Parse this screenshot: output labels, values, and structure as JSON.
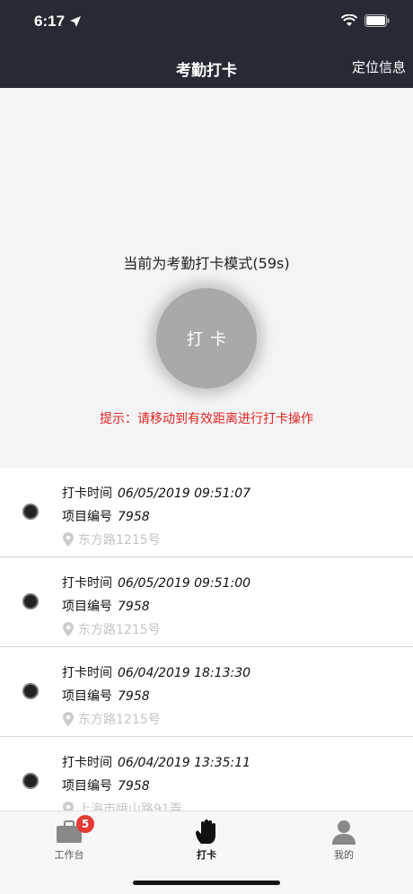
{
  "status": {
    "time": "6:17"
  },
  "nav": {
    "title": "考勤打卡",
    "right": "定位信息"
  },
  "main": {
    "mode_text": "当前为考勤打卡模式(59s)",
    "clock_button": "打卡",
    "hint": "提示：请移动到有效距离进行打卡操作"
  },
  "records": [
    {
      "time_label": "打卡时间",
      "time": "06/05/2019 09:51:07",
      "proj_label": "项目编号",
      "proj": "7958",
      "addr": "东方路1215号"
    },
    {
      "time_label": "打卡时间",
      "time": "06/05/2019 09:51:00",
      "proj_label": "项目编号",
      "proj": "7958",
      "addr": "东方路1215号"
    },
    {
      "time_label": "打卡时间",
      "time": "06/04/2019 18:13:30",
      "proj_label": "项目编号",
      "proj": "7958",
      "addr": "东方路1215号"
    },
    {
      "time_label": "打卡时间",
      "time": "06/04/2019 13:35:11",
      "proj_label": "项目编号",
      "proj": "7958",
      "addr": "上海市峨山路91弄"
    }
  ],
  "tabs": [
    {
      "label": "工作台",
      "icon": "briefcase-icon",
      "badge": "5"
    },
    {
      "label": "打卡",
      "icon": "hand-icon"
    },
    {
      "label": "我的",
      "icon": "person-icon"
    }
  ],
  "colors": {
    "header": "#262b33",
    "hint": "#e02424",
    "badge": "#e53935"
  }
}
